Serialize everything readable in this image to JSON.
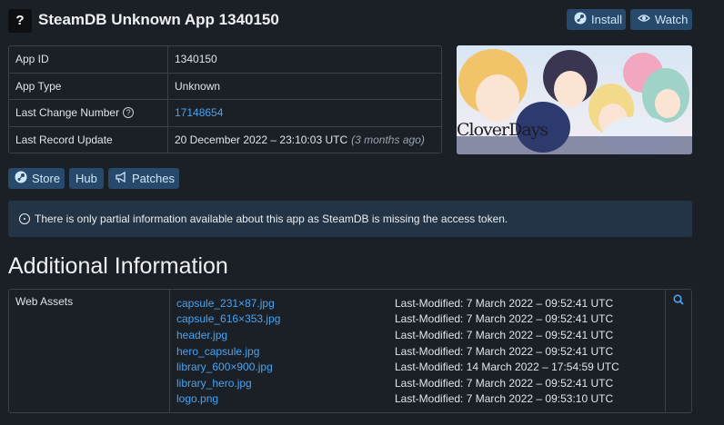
{
  "header": {
    "icon_glyph": "?",
    "title": "SteamDB Unknown App 1340150",
    "install_label": "Install",
    "watch_label": "Watch"
  },
  "info": [
    {
      "key": "App ID",
      "value": "1340150"
    },
    {
      "key": "App Type",
      "value": "Unknown"
    },
    {
      "key": "Last Change Number",
      "value": "17148654"
    },
    {
      "key": "Last Record Update",
      "value": "20 December 2022 – 23:10:03 UTC",
      "note": "(3 months ago)"
    }
  ],
  "capsule": {
    "logo_text": "CloverDays"
  },
  "links": {
    "store": "Store",
    "hub": "Hub",
    "patches": "Patches"
  },
  "notice": "There is only partial information available about this app as SteamDB is missing the access token.",
  "section_title": "Additional Information",
  "assets": {
    "label": "Web Assets",
    "rows": [
      {
        "file": "capsule_231×87.jpg",
        "modified": "Last-Modified: 7 March 2022 – 09:52:41 UTC"
      },
      {
        "file": "capsule_616×353.jpg",
        "modified": "Last-Modified: 7 March 2022 – 09:52:41 UTC"
      },
      {
        "file": "header.jpg",
        "modified": "Last-Modified: 7 March 2022 – 09:52:41 UTC"
      },
      {
        "file": "hero_capsule.jpg",
        "modified": "Last-Modified: 7 March 2022 – 09:52:41 UTC"
      },
      {
        "file": "library_600×900.jpg",
        "modified": "Last-Modified: 14 March 2022 – 17:54:59 UTC"
      },
      {
        "file": "library_hero.jpg",
        "modified": "Last-Modified: 7 March 2022 – 09:52:41 UTC"
      },
      {
        "file": "logo.png",
        "modified": "Last-Modified: 7 March 2022 – 09:53:10 UTC"
      }
    ]
  },
  "colors": {
    "background": "#1b1f26",
    "accent_link": "#4aa3f0",
    "button_bg": "#27496b",
    "notice_bg": "#243447"
  },
  "icons": {
    "install": "steam-icon",
    "watch": "eye-icon",
    "store": "steam-icon",
    "patches": "megaphone-icon",
    "notice": "info-icon",
    "assets_search": "search-icon",
    "help": "question-circle-icon"
  }
}
